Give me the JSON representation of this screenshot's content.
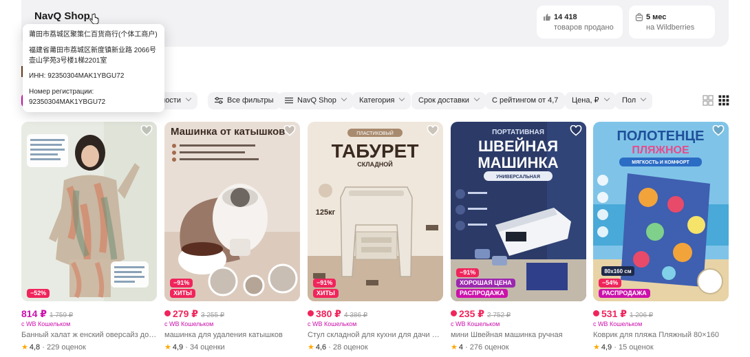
{
  "seller": {
    "name": "NavQ Shop",
    "stats": [
      {
        "value": "14 418",
        "label": "товаров продано",
        "icon": "thumbs-up-icon"
      },
      {
        "value": "5 мес",
        "label": "на Wildberries",
        "icon": "wb-bag-icon"
      }
    ]
  },
  "tooltip": {
    "company": "莆田市荔城区聚策仁百货商行(个体工商户)",
    "address": "福建省莆田市荔城区新度镇新业路 2066号壶山学苑3号楼1梯2201室",
    "inn": "ИНН: 92350304MAK1YBGU72",
    "reg": "Номер регистрации: 92350304MAK1YBGU72"
  },
  "filters": [
    {
      "label": "рности"
    },
    {
      "label": "Все фильтры",
      "icon": "filters-icon"
    },
    {
      "label": "NavQ Shop",
      "icon": "menu-icon"
    },
    {
      "label": "Категория"
    },
    {
      "label": "Срок доставки"
    },
    {
      "label": "С рейтингом от 4,7"
    },
    {
      "label": "Цена, ₽"
    },
    {
      "label": "Пол"
    }
  ],
  "products": [
    {
      "price": "814 ₽",
      "old": "1 759 ₽",
      "wb": "с WB Кошельком",
      "title": "Банный халат ж енский оверсайз домашний",
      "rating": "4,8",
      "reviews": "229 оценок",
      "badges": [
        "−52%"
      ],
      "hot": false
    },
    {
      "price": "279 ₽",
      "old": "3 255 ₽",
      "wb": "с WB Кошельком",
      "title": "машинка для удаления катышков",
      "rating": "4,9",
      "reviews": "34 оценки",
      "badges": [
        "−91%",
        "ХИТЫ"
      ],
      "hot": true
    },
    {
      "price": "380 ₽",
      "old": "4 386 ₽",
      "wb": "с WB Кошельком",
      "title": "Стул складной для кухни для дачи на балкон",
      "rating": "4,6",
      "reviews": "28 оценок",
      "badges": [
        "−91%",
        "ХИТЫ"
      ],
      "hot": true
    },
    {
      "price": "235 ₽",
      "old": "2 752 ₽",
      "wb": "с WB Кошельком",
      "title": "мини Швейная машинка ручная",
      "rating": "4",
      "reviews": "276 оценок",
      "badges": [
        "−91%",
        "ХОРОШАЯ ЦЕНА",
        "РАСПРОДАЖА"
      ],
      "hot": true
    },
    {
      "price": "531 ₽",
      "old": "1 206 ₽",
      "wb": "с WB Кошельком",
      "title": "Коврик для пляжа Пляжный 80×160",
      "rating": "4,9",
      "reviews": "15 оценок",
      "badges": [
        "−54%",
        "РАСПРОДАЖА"
      ],
      "hot": true
    }
  ],
  "image_texts": {
    "p2_headline": "Машинка от катышков",
    "p3_small": "ПЛАСТИКОВЫЙ",
    "p3_headline": "ТАБУРЕТ",
    "p3_sub": "СКЛАДНОЙ",
    "p3_load": "125кг",
    "p4_top": "ПОРТАТИВНАЯ",
    "p4_headline1": "ШВЕЙНАЯ",
    "p4_headline2": "МАШИНКА",
    "p4_sub": "УНИВЕРСАЛЬНАЯ",
    "p5_headline1": "ПОЛОТЕНЦЕ",
    "p5_headline2": "ПЛЯЖНОЕ",
    "p5_sub": "МЯГКОСТЬ И КОМФОРТ",
    "p5_size": "80x160 см"
  }
}
